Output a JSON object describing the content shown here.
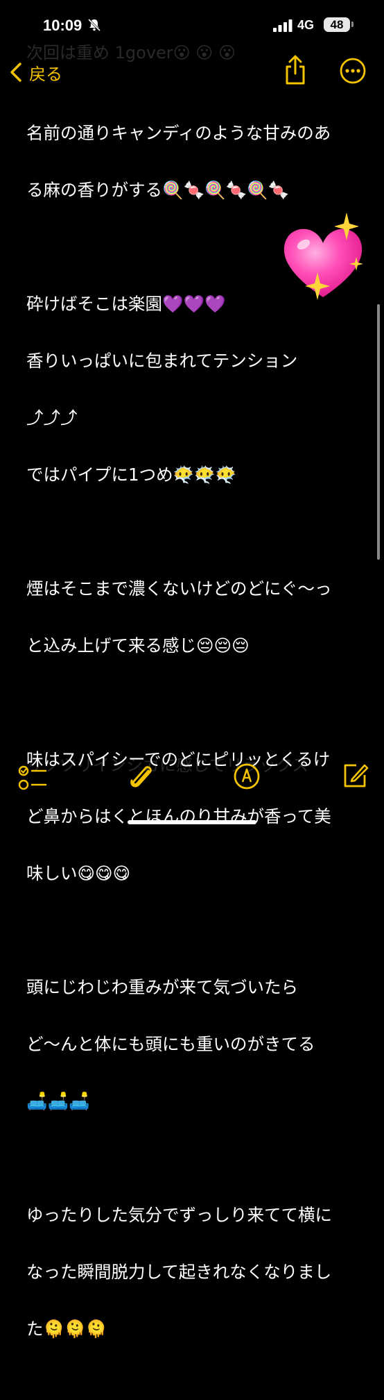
{
  "status_bar": {
    "time": "10:09",
    "network": "4G",
    "battery": "48"
  },
  "ghost_text": {
    "title": "次回は重め 1gover😮 😮 😮",
    "bottom": "リソツリインシカに感じてリラックス"
  },
  "nav": {
    "back_label": "戻る"
  },
  "note": {
    "paragraphs": [
      {
        "lines": [
          "名前の通りキャンディのような甘みのあ",
          "る麻の香りがする🍭🍬🍭🍬🍭🍬"
        ]
      },
      {
        "lines": [
          "砕けばそこは楽園💜💜💜",
          "香りいっぱいに包まれてテンション",
          "⤴⤴⤴",
          "ではパイプに1つめ😶‍🌫️😶‍🌫️😶‍🌫️"
        ]
      },
      {
        "lines": [
          "煙はそこまで濃くないけどのどにぐ〜っ",
          "と込み上げて来る感じ😔😔😔"
        ]
      },
      {
        "lines": [
          "味はスパイシーでのどにピリッとくるけ",
          "ど鼻からはくとほんのり甘みが香って美",
          "味しい😋😋😋"
        ]
      },
      {
        "lines": [
          "頭にじわじわ重みが来て気づいたら",
          "ど〜んと体にも頭にも重いのがきてる",
          "🛋️🛋️🛋️"
        ]
      },
      {
        "lines": [
          "ゆったりした気分でずっしり来てて横に",
          "なった瞬間脱力して起きれなくなりまし",
          "た🫠🫠🫠"
        ]
      }
    ]
  },
  "colors": {
    "accent": "#f5c400",
    "background": "#000000",
    "text": "#ffffff"
  },
  "toolbar": {
    "icons": [
      "checklist-icon",
      "attachment-icon",
      "markup-icon",
      "compose-icon"
    ]
  }
}
